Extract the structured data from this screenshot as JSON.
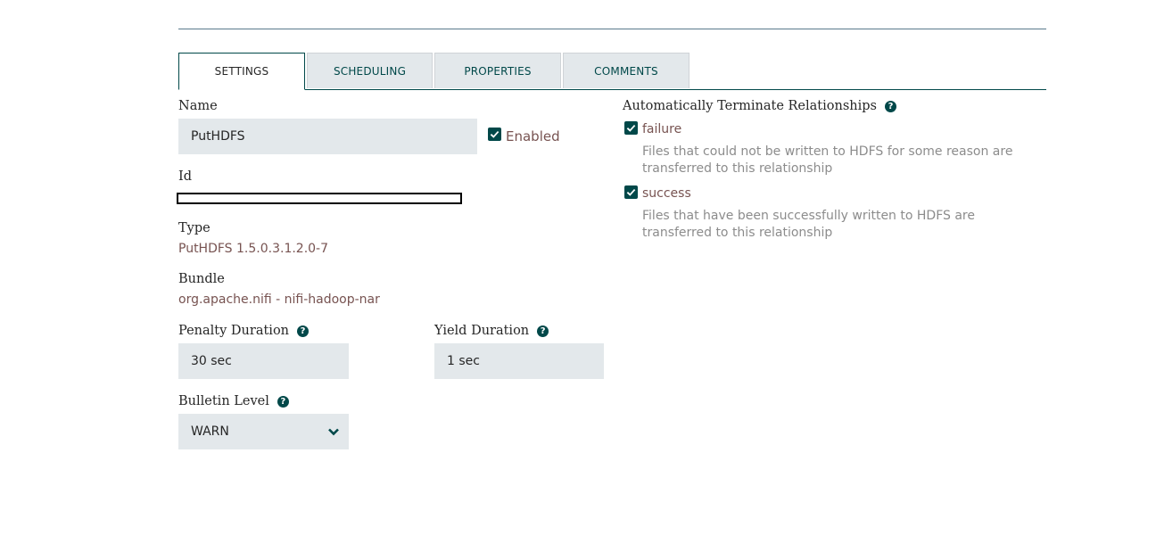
{
  "tabs": [
    {
      "label": "SETTINGS",
      "active": true
    },
    {
      "label": "SCHEDULING",
      "active": false
    },
    {
      "label": "PROPERTIES",
      "active": false
    },
    {
      "label": "COMMENTS",
      "active": false
    }
  ],
  "settings": {
    "name_label": "Name",
    "name_value": "PutHDFS",
    "enabled_label": "Enabled",
    "enabled_checked": true,
    "id_label": "Id",
    "type_label": "Type",
    "type_value": "PutHDFS 1.5.0.3.1.2.0-7",
    "bundle_label": "Bundle",
    "bundle_value": "org.apache.nifi - nifi-hadoop-nar",
    "penalty_label": "Penalty Duration",
    "penalty_value": "30 sec",
    "yield_label": "Yield Duration",
    "yield_value": "1 sec",
    "bulletin_label": "Bulletin Level",
    "bulletin_value": "WARN"
  },
  "relationships": {
    "title": "Automatically Terminate Relationships",
    "items": [
      {
        "name": "failure",
        "checked": true,
        "description": "Files that could not be written to HDFS for some reason are transferred to this relationship"
      },
      {
        "name": "success",
        "checked": true,
        "description": "Files that have been successfully written to HDFS are transferred to this relationship"
      }
    ]
  },
  "colors": {
    "accent": "#004849",
    "value_text": "#775351",
    "field_bg": "#e3e8eb"
  },
  "icons": {
    "help": "question-circle-icon",
    "check": "checkmark-icon",
    "dropdown": "chevron-down-icon"
  }
}
